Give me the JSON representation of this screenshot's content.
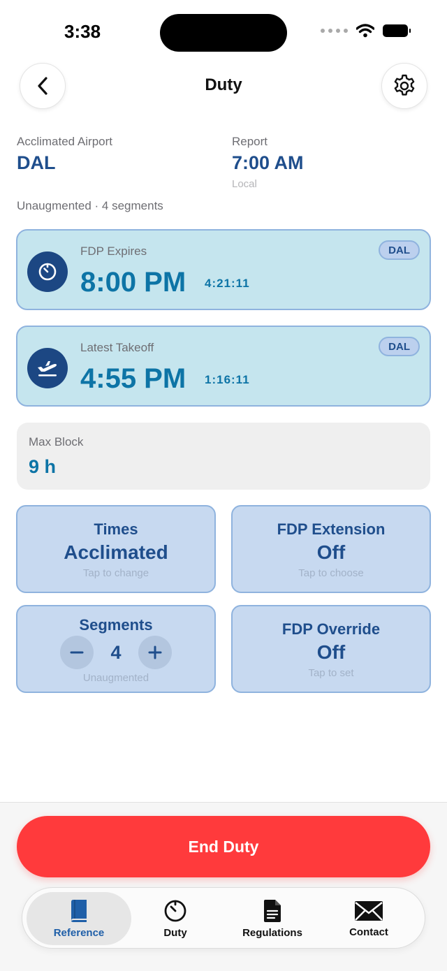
{
  "status_bar": {
    "time": "3:38"
  },
  "header": {
    "title": "Duty"
  },
  "info": {
    "acclimated_label": "Acclimated Airport",
    "acclimated_value": "DAL",
    "report_label": "Report",
    "report_value": "7:00 AM",
    "report_sub": "Local",
    "summary": "Unaugmented · 4 segments"
  },
  "fdp_card": {
    "label": "FDP Expires",
    "time": "8:00 PM",
    "countdown": "4:21:11",
    "badge": "DAL"
  },
  "takeoff_card": {
    "label": "Latest Takeoff",
    "time": "4:55 PM",
    "countdown": "1:16:11",
    "badge": "DAL"
  },
  "max_block": {
    "label": "Max Block",
    "value": "9 h"
  },
  "tiles": {
    "times": {
      "title": "Times",
      "value": "Acclimated",
      "hint": "Tap to change"
    },
    "extension": {
      "title": "FDP Extension",
      "value": "Off",
      "hint": "Tap to choose"
    },
    "segments": {
      "title": "Segments",
      "value": "4",
      "hint": "Unaugmented"
    },
    "override": {
      "title": "FDP Override",
      "value": "Off",
      "hint": "Tap to set"
    }
  },
  "end_duty_label": "End Duty",
  "tabs": [
    {
      "label": "Reference",
      "icon": "book-icon",
      "active": true
    },
    {
      "label": "Duty",
      "icon": "timer-icon",
      "active": false
    },
    {
      "label": "Regulations",
      "icon": "document-icon",
      "active": false
    },
    {
      "label": "Contact",
      "icon": "envelope-icon",
      "active": false
    }
  ],
  "colors": {
    "accent_dark": "#1f4e8c",
    "accent_time": "#0d74a6",
    "card_bg": "#c5e5ee",
    "tile_bg": "#c7d9f0",
    "danger": "#ff3a3c"
  }
}
